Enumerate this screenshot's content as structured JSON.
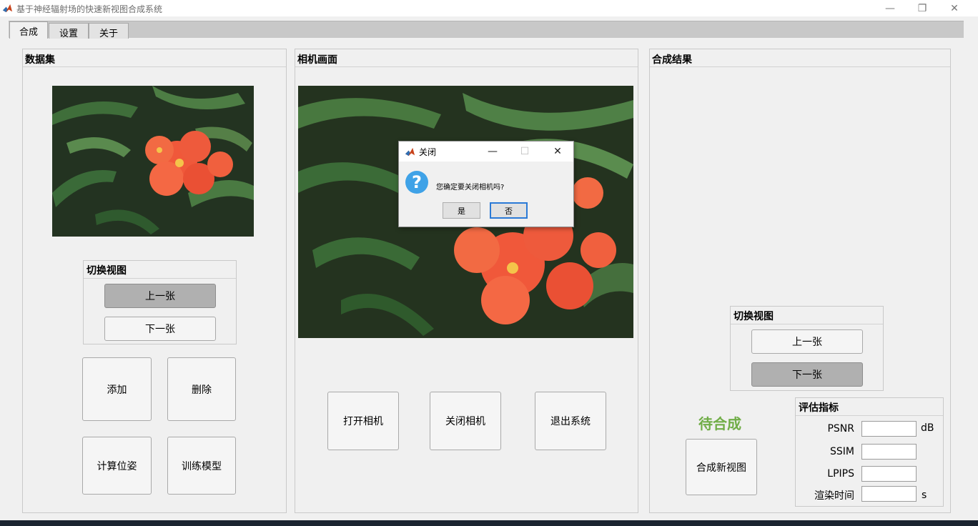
{
  "window": {
    "title": "基于神经辐射场的快速新视图合成系统",
    "minimize": "—",
    "maximize": "❐",
    "close": "✕"
  },
  "tabs": [
    {
      "label": "合成",
      "active": true
    },
    {
      "label": "设置",
      "active": false
    },
    {
      "label": "关于",
      "active": false
    }
  ],
  "dataset_panel": {
    "title": "数据集",
    "switch_view": {
      "title": "切换视图",
      "prev": "上一张",
      "next": "下一张"
    },
    "add": "添加",
    "delete": "删除",
    "compute_pose": "计算位姿",
    "train_model": "训练模型"
  },
  "camera_panel": {
    "title": "相机画面",
    "open_camera": "打开相机",
    "close_camera": "关闭相机",
    "exit_system": "退出系统"
  },
  "result_panel": {
    "title": "合成结果",
    "switch_view": {
      "title": "切换视图",
      "prev": "上一张",
      "next": "下一张"
    },
    "status": "待合成",
    "synthesize": "合成新视图",
    "metrics": {
      "title": "评估指标",
      "psnr_label": "PSNR",
      "psnr_unit": "dB",
      "ssim_label": "SSIM",
      "lpips_label": "LPIPS",
      "render_time_label": "渲染时间",
      "render_time_unit": "s",
      "psnr_value": "",
      "ssim_value": "",
      "lpips_value": "",
      "render_time_value": ""
    }
  },
  "dialog": {
    "title": "关闭",
    "message": "您确定要关闭相机吗?",
    "yes": "是",
    "no": "否",
    "icon": "question-icon"
  },
  "colors": {
    "status_green": "#70ad47",
    "accent_blue": "#3fa2e7"
  }
}
